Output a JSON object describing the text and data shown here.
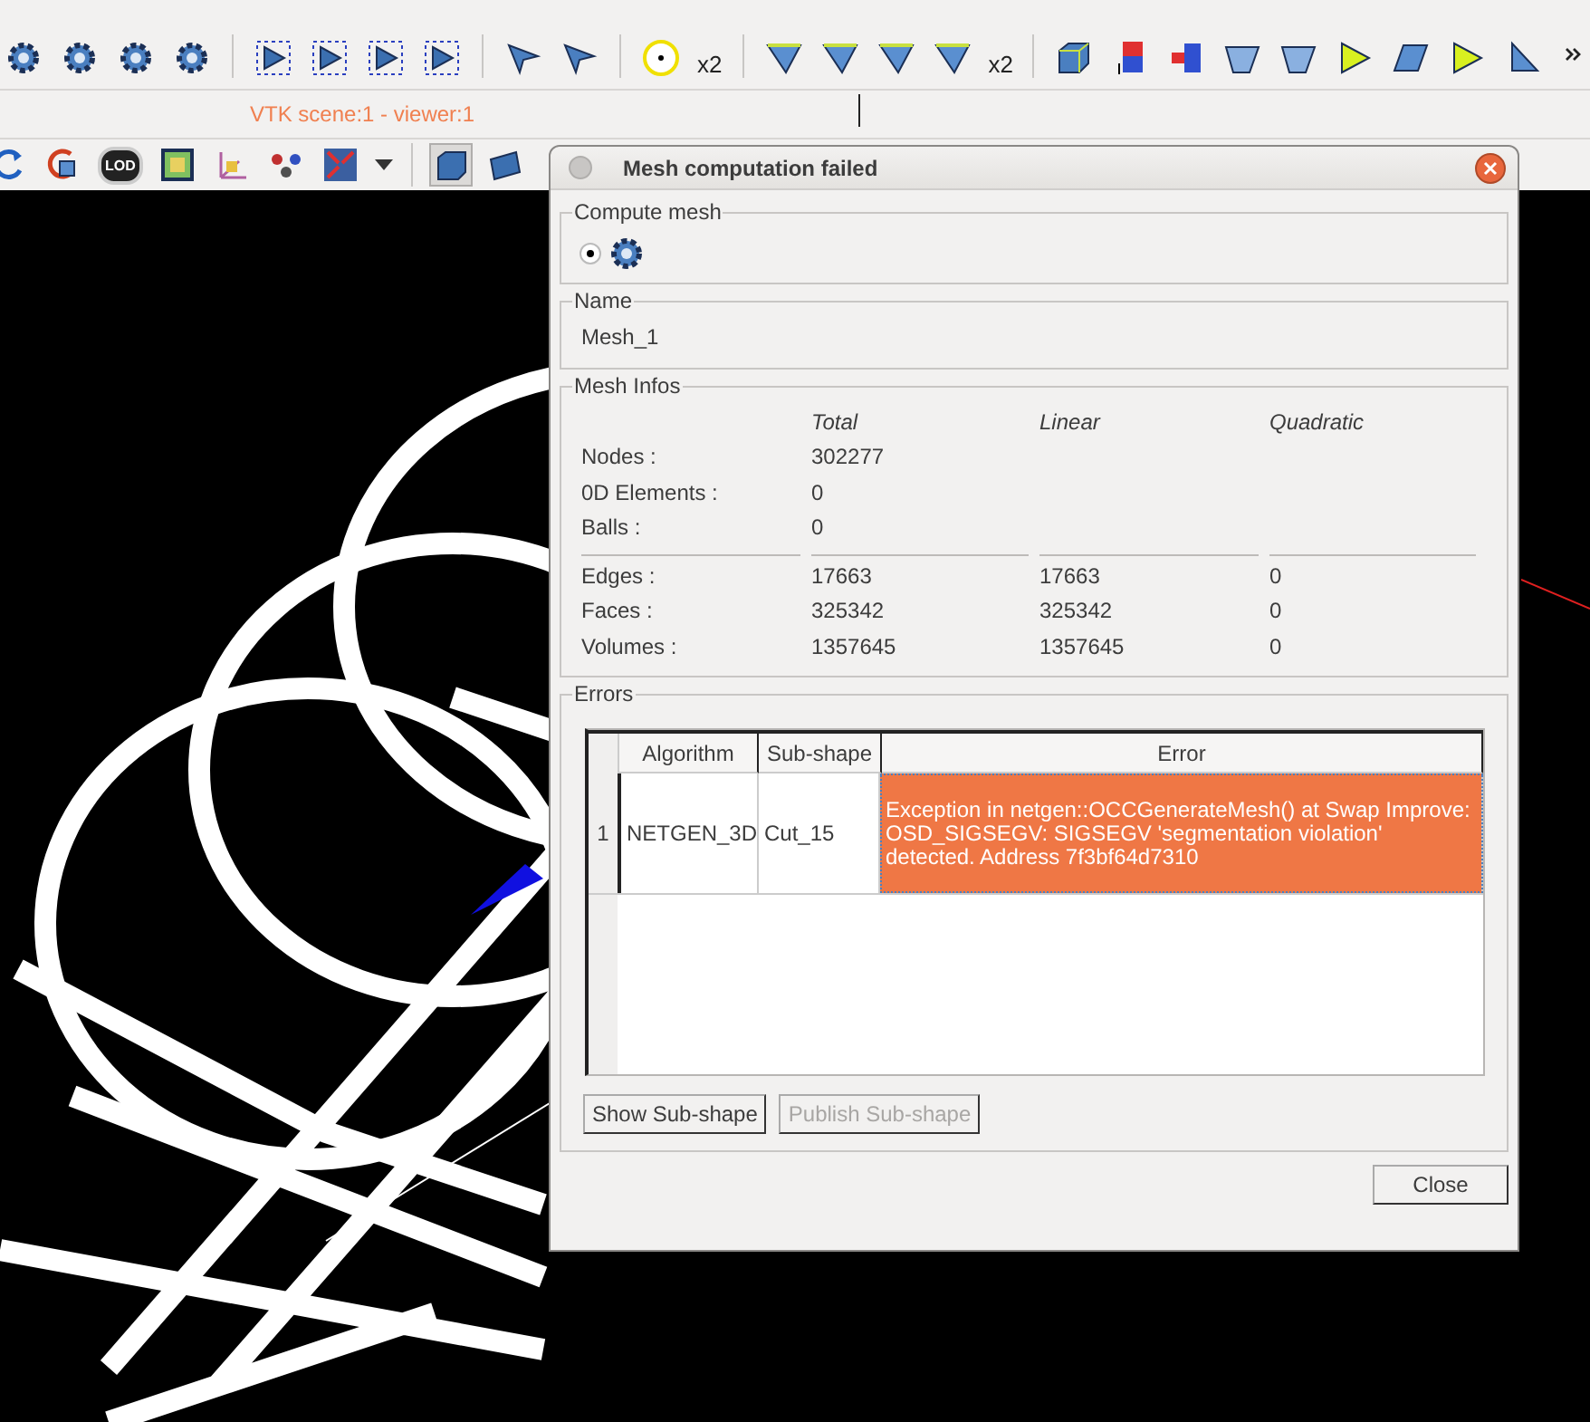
{
  "toolbar": {
    "badges": [
      "x2",
      "x2"
    ]
  },
  "viewer": {
    "title": "VTK scene:1 - viewer:1"
  },
  "view_toolbar": {
    "lod_label": "LOD"
  },
  "dialog": {
    "title": "Mesh computation failed",
    "compute_mesh": {
      "legend": "Compute mesh",
      "radio_checked": true
    },
    "name": {
      "legend": "Name",
      "value": "Mesh_1"
    },
    "mesh_infos": {
      "legend": "Mesh Infos",
      "columns": [
        "Total",
        "Linear",
        "Quadratic"
      ],
      "groups": [
        [
          {
            "label": "Nodes :",
            "values": [
              "302277"
            ]
          },
          {
            "label": "0D Elements :",
            "values": [
              "0"
            ]
          },
          {
            "label": "Balls :",
            "values": [
              "0"
            ]
          }
        ],
        [
          {
            "label": "Edges :",
            "values": [
              "17663",
              "17663",
              "0"
            ]
          },
          {
            "label": "Faces :",
            "values": [
              "325342",
              "325342",
              "0"
            ]
          },
          {
            "label": "Volumes :",
            "values": [
              "1357645",
              "1357645",
              "0"
            ]
          }
        ]
      ]
    },
    "errors": {
      "legend": "Errors",
      "columns": [
        "Algorithm",
        "Sub-shape",
        "Error"
      ],
      "rows": [
        {
          "number": "1",
          "cells": [
            {
              "text": "NETGEN_3D",
              "selected": false
            },
            {
              "text": "Cut_15",
              "selected": false
            },
            {
              "text": "Exception in  netgen::OCCGenerateMesh() at Swap Improve: OSD_SIGSEGV: SIGSEGV 'segmentation violation' detected. Address 7f3bf64d7310",
              "selected": true
            }
          ]
        }
      ]
    },
    "buttons": [
      {
        "label": "Show Sub-shape",
        "disabled": false
      },
      {
        "label": "Publish Sub-shape",
        "disabled": true
      }
    ],
    "close_button": "Close"
  }
}
